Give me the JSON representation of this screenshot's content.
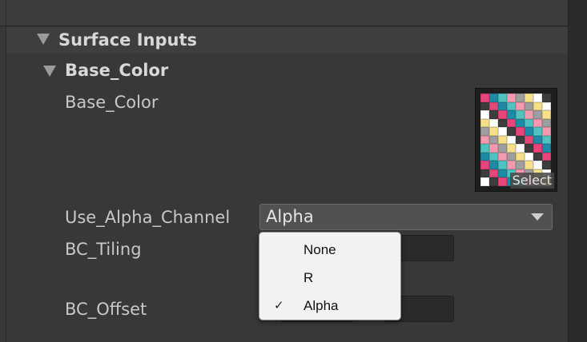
{
  "section": {
    "title": "Surface Inputs"
  },
  "group": {
    "title": "Base_Color"
  },
  "properties": {
    "base_color_label": "Base_Color",
    "use_alpha_label": "Use_Alpha_Channel",
    "tiling_label": "BC_Tiling",
    "offset_label": "BC_Offset"
  },
  "texture": {
    "select_label": "Select"
  },
  "use_alpha_dropdown": {
    "selected": "Alpha",
    "options": [
      {
        "label": "None",
        "checked": false
      },
      {
        "label": "R",
        "checked": false
      },
      {
        "label": "Alpha",
        "checked": true
      }
    ],
    "check_glyph": "✓"
  },
  "colors": {
    "background": "#383838",
    "popup_background": "#f2f2f2",
    "texture_palette": [
      "#e8457a",
      "#f6e08a",
      "#4fc3c0",
      "#3d3d3d",
      "#9e9e9e",
      "#1f8aa6",
      "#ffffff",
      "#f49ab0"
    ]
  }
}
